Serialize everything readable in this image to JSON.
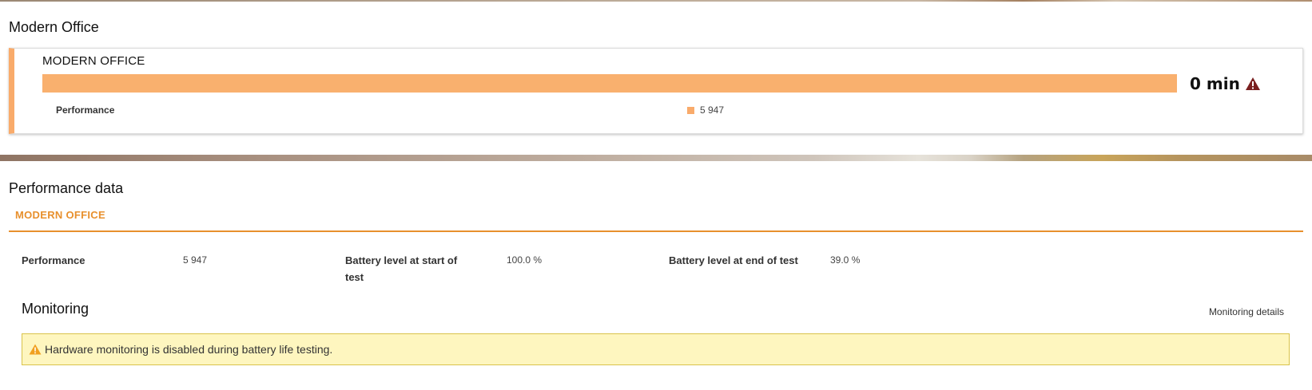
{
  "test_section": {
    "title": "Modern Office",
    "card_heading": "MODERN OFFICE",
    "bar_fill_percent": 100,
    "bar_color": "#f9b06e",
    "duration": "0 min",
    "duration_icon": "warning-triangle-icon",
    "performance_label": "Performance",
    "legend_value": "5 947"
  },
  "performance_data": {
    "title": "Performance data",
    "tab_label": "MODERN OFFICE",
    "accent_color": "#e8902d",
    "stats": [
      {
        "label": "Performance",
        "value": "5 947"
      },
      {
        "label": "Battery level at start of test",
        "value": "100.0 %"
      },
      {
        "label": "Battery level at end of test",
        "value": "39.0 %"
      }
    ]
  },
  "monitoring": {
    "title": "Monitoring",
    "details_link": "Monitoring details",
    "alert_icon": "warning-triangle-icon",
    "alert_text": "Hardware monitoring is disabled during battery life testing."
  }
}
